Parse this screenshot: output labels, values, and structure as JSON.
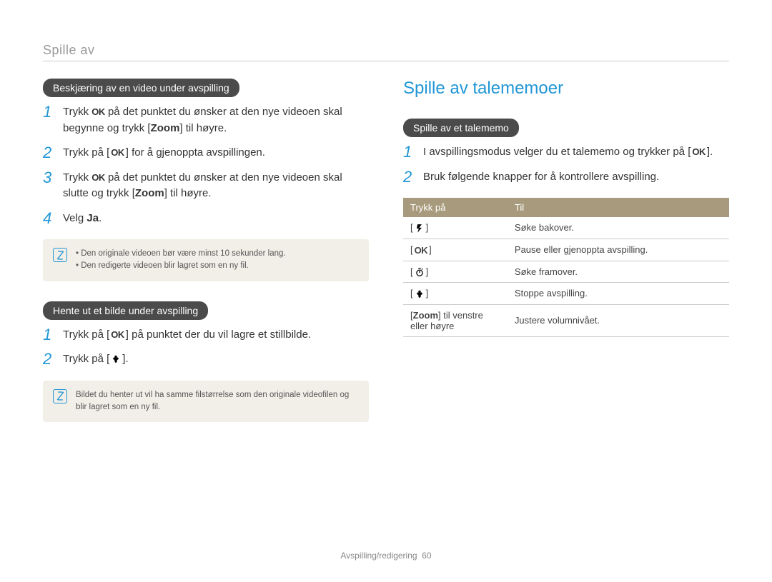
{
  "header": {
    "title": "Spille av"
  },
  "left": {
    "pill1": "Beskjæring av en video under avspilling",
    "steps1": [
      {
        "pre": "Trykk ",
        "ok": true,
        "post": " på det punktet du ønsker at den nye videoen skal begynne og trykk [",
        "bold": "Zoom",
        "post2": "] til høyre."
      },
      {
        "pre": "Trykk på ",
        "ok_brkt": true,
        "post": " for å gjenoppta avspillingen."
      },
      {
        "pre": "Trykk ",
        "ok": true,
        "post": " på det punktet du ønsker at den nye videoen skal slutte og trykk [",
        "bold": "Zoom",
        "post2": "] til høyre."
      },
      {
        "pre": "Velg ",
        "bold": "Ja",
        "post2": "."
      }
    ],
    "note1": {
      "items": [
        "Den originale videoen bør være minst 10 sekunder lang.",
        "Den redigerte videoen blir lagret som en ny fil."
      ]
    },
    "pill2": "Hente ut et bilde under avspilling",
    "steps2": [
      {
        "pre": "Trykk på ",
        "ok_brkt": true,
        "post": " på punktet der du vil lagre et stillbilde."
      },
      {
        "pre": "Trykk på ",
        "macro_brkt": true,
        "post": "."
      }
    ],
    "note2": {
      "text": "Bildet du henter ut vil ha samme filstørrelse som den originale videofilen og blir lagret som en ny fil."
    }
  },
  "right": {
    "title": "Spille av talememoer",
    "pill": "Spille av et talememo",
    "steps": [
      {
        "pre": "I avspillingsmodus velger du et talememo og trykker på ",
        "ok_brkt": true,
        "post": "."
      },
      {
        "pre": "Bruk følgende knapper for å kontrollere avspilling."
      }
    ],
    "table": {
      "headers": [
        "Trykk på",
        "Til"
      ],
      "rows": [
        {
          "key_icon": "flash",
          "desc": "Søke bakover."
        },
        {
          "key_icon": "ok",
          "desc": "Pause eller gjenoppta avspilling."
        },
        {
          "key_icon": "timer",
          "desc": "Søke framover."
        },
        {
          "key_icon": "macro",
          "desc": "Stoppe avspilling."
        },
        {
          "key_text_pre": "[",
          "key_bold": "Zoom",
          "key_text_post": "] til venstre eller høyre",
          "desc": "Justere volumnivået."
        }
      ]
    }
  },
  "footer": {
    "section": "Avspilling/redigering",
    "page": "60"
  }
}
